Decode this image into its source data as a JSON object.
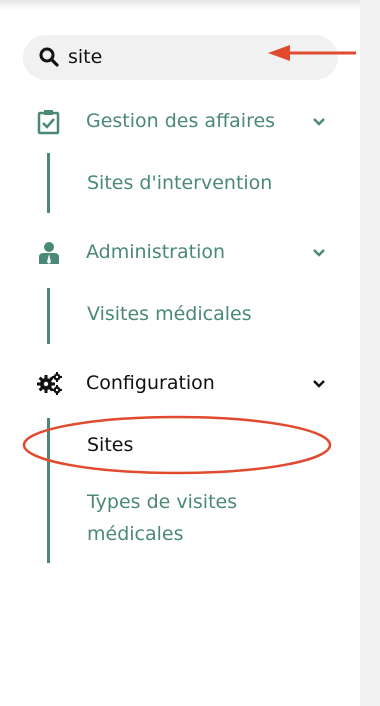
{
  "search": {
    "value": "site"
  },
  "sections": [
    {
      "label": "Gestion des affaires",
      "icon": "clipboard-check-icon",
      "items": [
        "Sites d'intervention"
      ]
    },
    {
      "label": "Administration",
      "icon": "person-icon",
      "items": [
        "Visites médicales"
      ]
    },
    {
      "label": "Configuration",
      "icon": "gears-icon",
      "items": [
        "Sites",
        "Types de visites médicales"
      ]
    }
  ],
  "colors": {
    "accent": "#4a8878",
    "annotation": "#e04a2f",
    "text_dark": "#111111"
  }
}
